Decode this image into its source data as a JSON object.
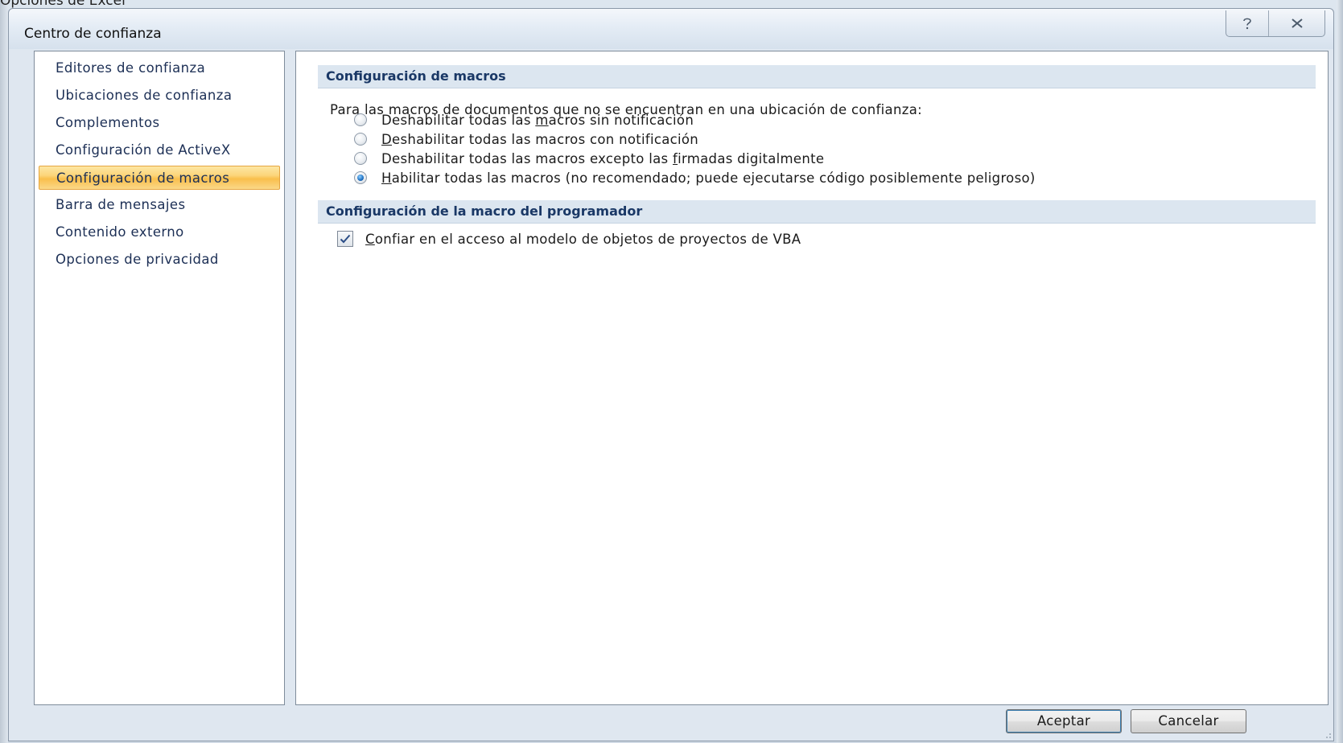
{
  "background_window": {
    "title": "Opciones de Excel"
  },
  "dialog": {
    "title": "Centro de confianza",
    "help_icon": "question-mark-icon",
    "close_icon": "close-x-icon",
    "accent_selected": "#f9bf4c",
    "header_bg": "#dce6f0"
  },
  "nav": {
    "items": [
      {
        "label": "Editores de confianza"
      },
      {
        "label": "Ubicaciones de confianza"
      },
      {
        "label": "Complementos"
      },
      {
        "label": "Configuración de ActiveX"
      },
      {
        "label": "Configuración de macros",
        "selected": true
      },
      {
        "label": "Barra de mensajes"
      },
      {
        "label": "Contenido externo"
      },
      {
        "label": "Opciones de privacidad"
      }
    ]
  },
  "macros": {
    "header": "Configuración de macros",
    "intro": "Para las macros de documentos que no se encuentran en una ubicación de confianza:",
    "options": [
      {
        "pre": "Deshabilitar todas las ",
        "mnemonic": "m",
        "post": "acros sin notificación",
        "checked": false
      },
      {
        "pre": "",
        "mnemonic": "D",
        "post": "eshabilitar todas las macros con notificación",
        "checked": false
      },
      {
        "pre": "Deshabilitar todas las macros excepto las ",
        "mnemonic": "f",
        "post": "irmadas digitalmente",
        "checked": false
      },
      {
        "pre": "",
        "mnemonic": "H",
        "post": "abilitar todas las macros (no recomendado; puede ejecutarse código posiblemente peligroso)",
        "checked": true
      }
    ]
  },
  "developer": {
    "header": "Configuración de la macro del programador",
    "checkbox": {
      "mnemonic": "C",
      "post": "onfiar en el acceso al modelo de objetos de proyectos de VBA",
      "checked": true
    }
  },
  "footer": {
    "ok_label": "Aceptar",
    "cancel_label": "Cancelar"
  }
}
